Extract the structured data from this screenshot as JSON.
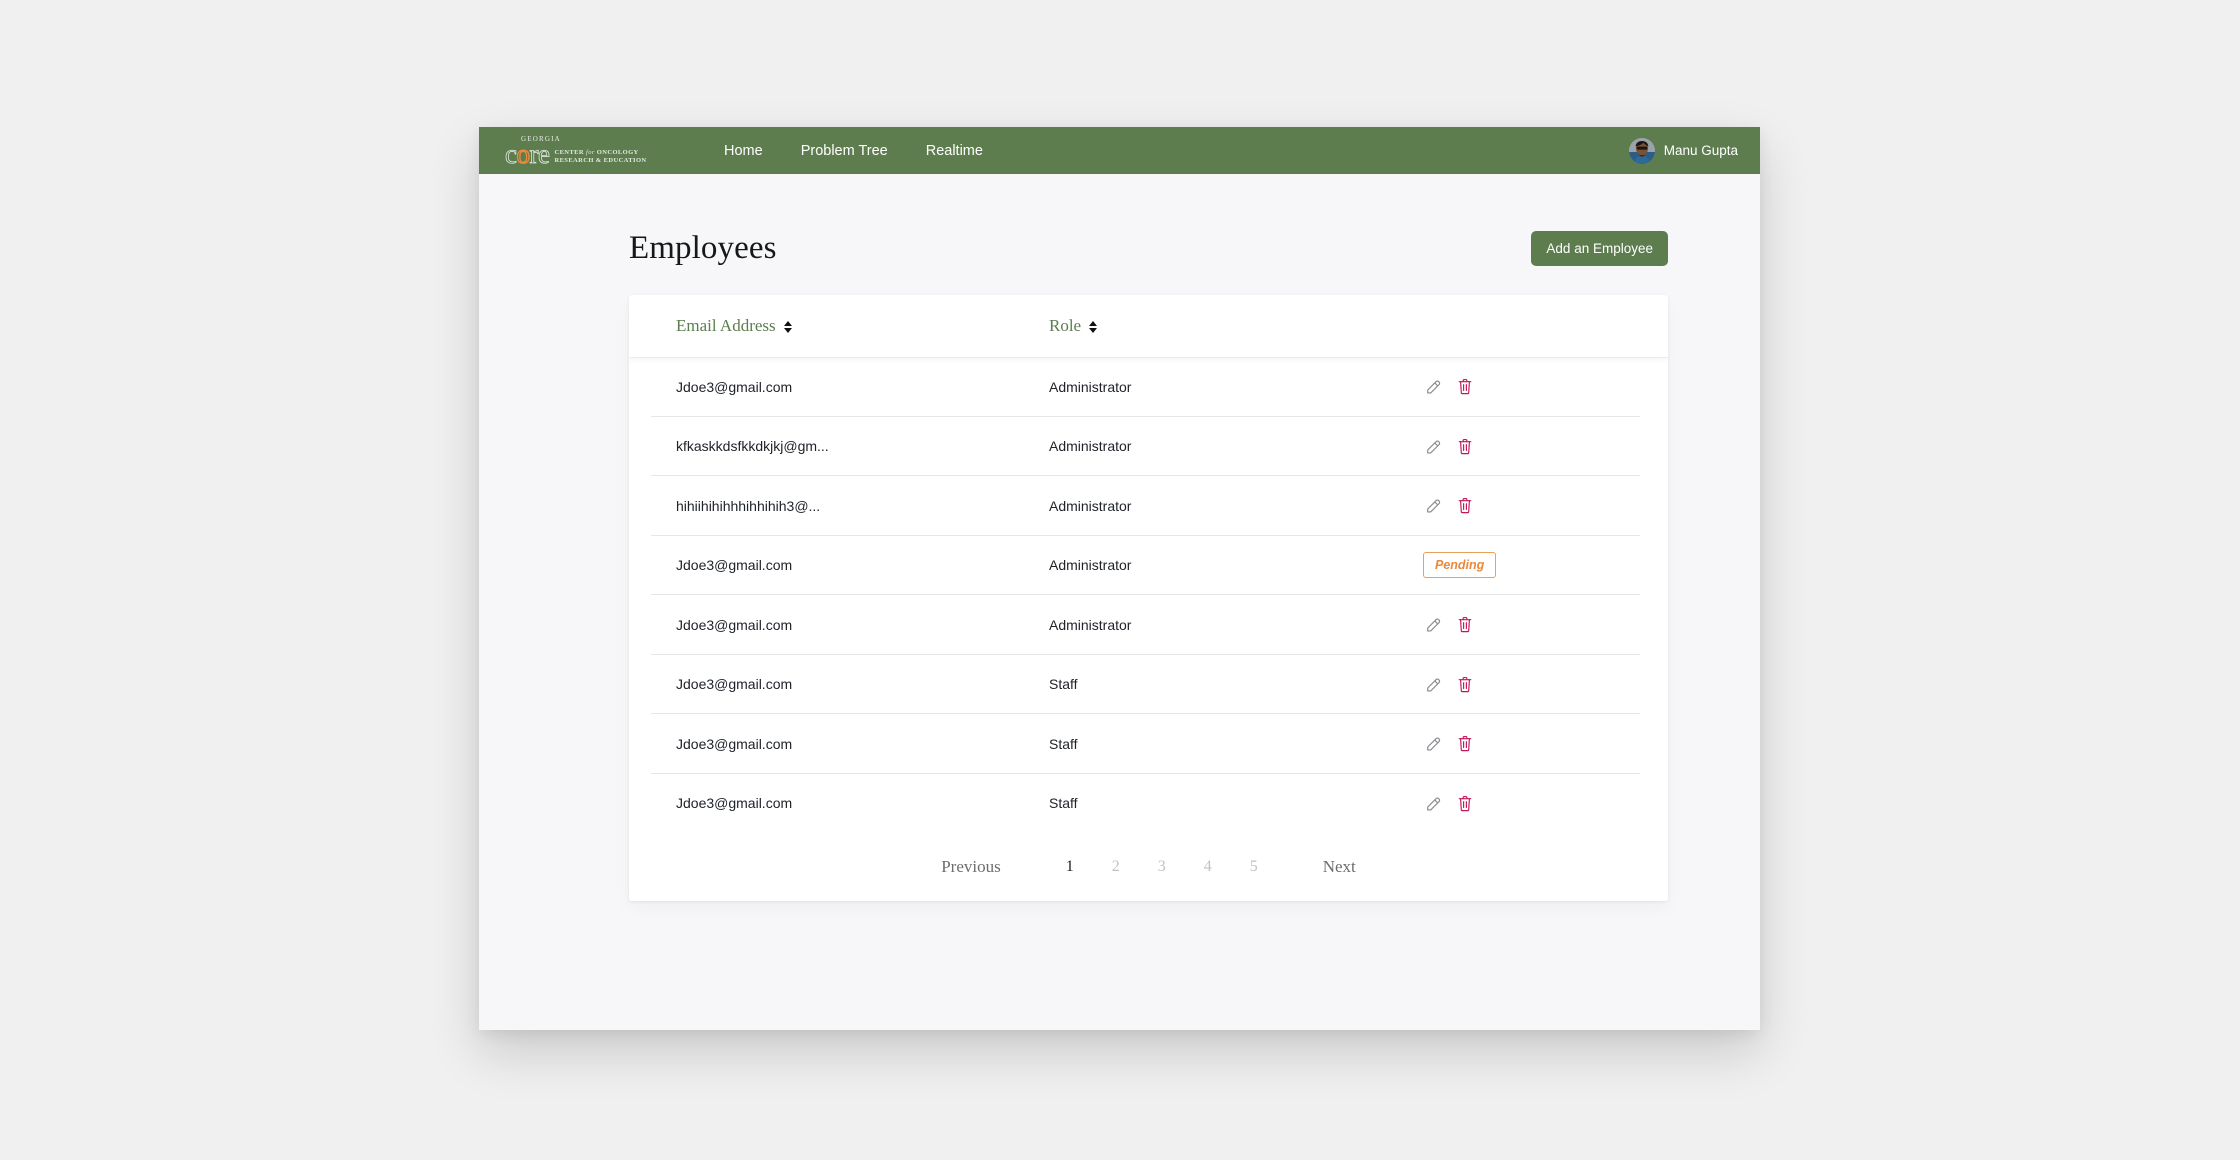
{
  "navbar": {
    "brand": {
      "top_text": "GEORGIA",
      "word_before": "c",
      "word_orange": "o",
      "word_after": "re",
      "tagline_line1_a": "CENTER ",
      "tagline_line1_i": "for",
      "tagline_line1_b": " ONCOLOGY",
      "tagline_line2": "RESEARCH & EDUCATION"
    },
    "links": [
      {
        "label": "Home"
      },
      {
        "label": "Problem Tree"
      },
      {
        "label": "Realtime"
      }
    ],
    "user": {
      "name": "Manu Gupta",
      "avatar_icon": "user-photo-avatar"
    },
    "background_color": "#5d7d4f"
  },
  "page": {
    "title": "Employees",
    "add_button_label": "Add an Employee",
    "accent_color": "#5d7d4f",
    "background_color": "#f7f7f9"
  },
  "table": {
    "columns": [
      {
        "label": "Email Address",
        "sortable": true
      },
      {
        "label": "Role",
        "sortable": true
      }
    ],
    "rows": [
      {
        "email": "Jdoe3@gmail.com",
        "role": "Administrator",
        "status": null,
        "actions": [
          "edit",
          "delete"
        ]
      },
      {
        "email": "kfkaskkdsfkkdkjkj@gm...",
        "role": "Administrator",
        "status": null,
        "actions": [
          "edit",
          "delete"
        ]
      },
      {
        "email": "hihiihihihhhihhihih3@...",
        "role": "Administrator",
        "status": null,
        "actions": [
          "edit",
          "delete"
        ]
      },
      {
        "email": "Jdoe3@gmail.com",
        "role": "Administrator",
        "status": "Pending",
        "actions": []
      },
      {
        "email": "Jdoe3@gmail.com",
        "role": "Administrator",
        "status": null,
        "actions": [
          "edit",
          "delete"
        ]
      },
      {
        "email": "Jdoe3@gmail.com",
        "role": "Staff",
        "status": null,
        "actions": [
          "edit",
          "delete"
        ]
      },
      {
        "email": "Jdoe3@gmail.com",
        "role": "Staff",
        "status": null,
        "actions": [
          "edit",
          "delete"
        ]
      },
      {
        "email": "Jdoe3@gmail.com",
        "role": "Staff",
        "status": null,
        "actions": [
          "edit",
          "delete"
        ]
      }
    ],
    "status_colors": {
      "pending_text": "#e8893c",
      "pending_border": "#e8a05c"
    },
    "icon_colors": {
      "edit": "#8a8a90",
      "delete": "#c2185b"
    }
  },
  "pagination": {
    "previous_label": "Previous",
    "next_label": "Next",
    "pages": [
      "1",
      "2",
      "3",
      "4",
      "5"
    ],
    "active_page": "1"
  }
}
